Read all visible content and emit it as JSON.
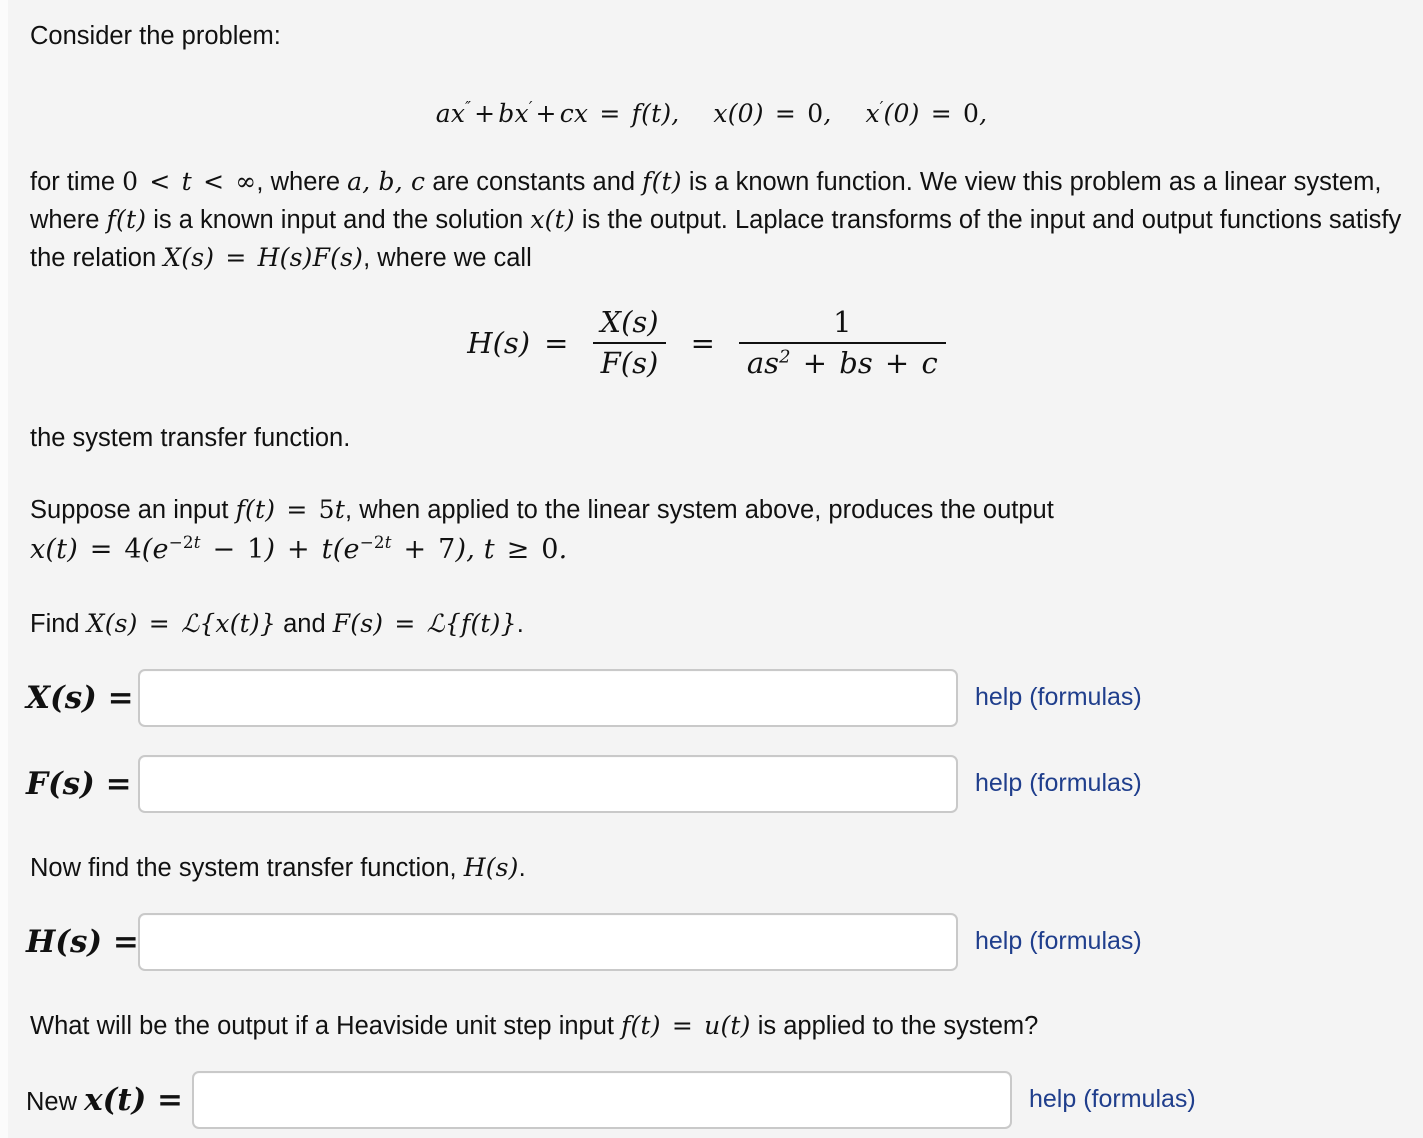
{
  "page": {
    "background_color": "#f4f4f4",
    "text_color": "#111111",
    "link_color": "#1f3e8c",
    "input_border_color": "#c9c9c9",
    "input_background_color": "#ffffff"
  },
  "intro": {
    "lead": "Consider the problem:",
    "equation": {
      "lhs": "ax″ + bx′ + cx = f(t),",
      "ic1": "x(0) = 0,",
      "ic2": "x′(0) = 0,",
      "plain": "ax″ + bx′ + cx = f(t),   x(0) = 0,   x′(0) = 0,",
      "coef_a": "a",
      "coef_b": "b",
      "coef_c": "c",
      "var_x": "x",
      "func_f": "f",
      "var_t": "t",
      "zero": "0"
    }
  },
  "paragraph1": {
    "part1": "for time ",
    "range": "0 < t < ∞",
    "part2": ", where ",
    "constants": "a, b, c",
    "part3": " are constants and ",
    "known_fn": "f(t)",
    "part4": " is a known function. We view this problem as a linear system, where ",
    "input_fn": "f(t)",
    "part5": " is a known input and the solution ",
    "output_fn": "x(t)",
    "part6": " is the output. Laplace transforms of the input and output functions satisfy the relation ",
    "relation": "X(s) = H(s)F(s)",
    "part7": ", where we call"
  },
  "transfer_equation": {
    "lhs": "H(s)",
    "equals": "=",
    "frac1_num": "X(s)",
    "frac1_den": "F(s)",
    "equals2": "=",
    "frac2_num": "1",
    "frac2_den": "as² + bs + c",
    "plain": "H(s) = X(s)/F(s) = 1/(as² + bs + c)"
  },
  "paragraph2": {
    "text": "the system transfer function."
  },
  "paragraph3": {
    "part1": "Suppose an input ",
    "input": "f(t) = 5t",
    "part2": ", when applied to the linear system above, produces the output",
    "output_equation": "x(t) = 4(e⁻²ᵗ − 1) + t(e⁻²ᵗ + 7), t ≥ 0.",
    "output_coefficient": "4",
    "output_exponent": "−2t",
    "output_inner1": "− 1",
    "output_inner2": "+ 7",
    "output_domain": "t ≥ 0"
  },
  "paragraph4": {
    "part1": "Find ",
    "x_transform": "X(s) = ℒ{x(t)}",
    "part2": " and ",
    "f_transform": "F(s) = ℒ{f(t)}",
    "part3": "."
  },
  "answers": [
    {
      "id": "x-of-s",
      "label": "X(s) =",
      "label_prefix": "",
      "value": "",
      "placeholder": "",
      "help_label": "help (formulas)"
    },
    {
      "id": "f-of-s",
      "label": "F(s) =",
      "label_prefix": "",
      "value": "",
      "placeholder": "",
      "help_label": "help (formulas)"
    },
    {
      "id": "h-of-s",
      "label": "H(s) =",
      "label_prefix": "",
      "value": "",
      "placeholder": "",
      "help_label": "help (formulas)"
    },
    {
      "id": "new-x-of-t",
      "label": "x(t) =",
      "label_prefix": "New ",
      "value": "",
      "placeholder": "",
      "help_label": "help (formulas)"
    }
  ],
  "paragraph5": {
    "part1": "Now find the system transfer function, ",
    "symbol": "H(s)",
    "part2": "."
  },
  "paragraph6": {
    "part1": "What will be the output if a Heaviside unit step input ",
    "step_input": "f(t) = u(t)",
    "part2": " is applied to the system?"
  }
}
